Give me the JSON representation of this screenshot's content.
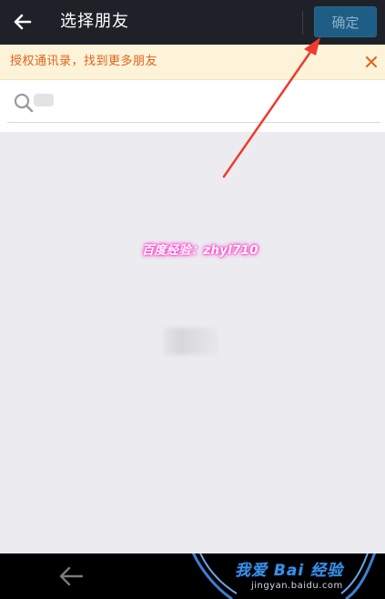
{
  "header": {
    "back_icon": "arrow-left-icon",
    "title": "选择朋友",
    "confirm_label": "确定"
  },
  "notice": {
    "text": "授权通讯录，找到更多朋友",
    "close_icon": "close-icon"
  },
  "search": {
    "icon": "search-icon",
    "placeholder": ""
  },
  "watermark": {
    "text": "百度经验：zhyl710"
  },
  "bottom_bar": {
    "back_icon": "arrow-left-icon",
    "site_brand": "我爱 Bai 经验",
    "site_url": "jingyan.baidu.com"
  },
  "colors": {
    "header_bg": "#1e2228",
    "confirm_bg": "#1d5d86",
    "notice_bg": "#fdf3d8",
    "notice_text": "#e2621b",
    "content_bg": "#ececf0",
    "annotation_arrow": "#f03a2e"
  }
}
